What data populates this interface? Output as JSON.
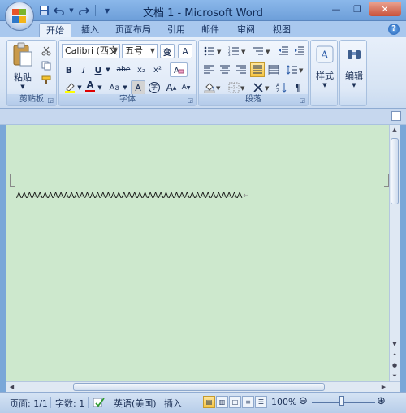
{
  "app": {
    "title": "文档 1 - Microsoft Word",
    "qat": [
      "save-icon",
      "undo-icon",
      "redo-icon",
      "customize-icon"
    ]
  },
  "tabs": [
    {
      "label": "开始",
      "active": true
    },
    {
      "label": "插入"
    },
    {
      "label": "页面布局"
    },
    {
      "label": "引用"
    },
    {
      "label": "邮件"
    },
    {
      "label": "审阅"
    },
    {
      "label": "视图"
    }
  ],
  "ribbon": {
    "clipboard": {
      "label": "剪贴板",
      "paste_label": "粘贴"
    },
    "font": {
      "label": "字体",
      "font_name": "Calibri (西文正文)",
      "font_size": "五号",
      "bold": "B",
      "italic": "I",
      "underline": "U",
      "strike": "abe",
      "subscript": "x₂",
      "superscript": "x²",
      "font_color": "A",
      "change_case": "Aa",
      "char_shading": "A",
      "enclose": "字",
      "grow": "A",
      "shrink": "A",
      "phonetic": "变",
      "char_border": "A"
    },
    "paragraph": {
      "label": "段落"
    },
    "styles": {
      "label": "样式"
    },
    "editing": {
      "label": "编辑"
    }
  },
  "document": {
    "text": "AAAAAAAAAAAAAAAAAAAAAAAAAAAAAAAAAAAAAAAAAAA",
    "pilcrow": "↵"
  },
  "statusbar": {
    "page": "页面: 1/1",
    "words": "字数: 1",
    "language": "英语(美国)",
    "mode": "插入",
    "zoom": "100%"
  },
  "colors": {
    "doc_background": "#cde8cd",
    "ribbon": "#dfe9f7",
    "titlebar": "#7aa7d8"
  }
}
